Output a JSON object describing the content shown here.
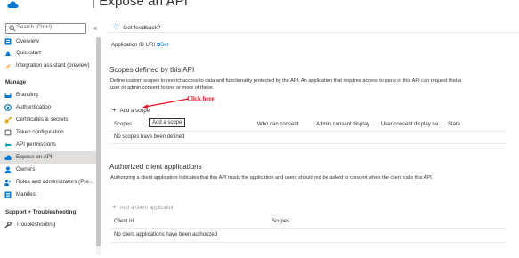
{
  "header": {
    "title": "Expose an API",
    "pin_icon": "pin-icon",
    "logo_icon": "azure-cloud-icon"
  },
  "sidebar": {
    "search_placeholder": "Search (Ctrl+/)",
    "collapse_glyph": "«",
    "items_top": [
      {
        "label": "Overview",
        "icon": "overview-icon"
      },
      {
        "label": "Quickstart",
        "icon": "quickstart-icon"
      },
      {
        "label": "Integration assistant (preview)",
        "icon": "rocket-icon"
      }
    ],
    "manage_heading": "Manage",
    "items_manage": [
      {
        "label": "Branding",
        "icon": "branding-icon"
      },
      {
        "label": "Authentication",
        "icon": "authentication-icon"
      },
      {
        "label": "Certificates & secrets",
        "icon": "key-icon"
      },
      {
        "label": "Token configuration",
        "icon": "token-icon"
      },
      {
        "label": "API permissions",
        "icon": "api-permissions-icon"
      },
      {
        "label": "Expose an API",
        "icon": "cloud-icon",
        "active": true
      },
      {
        "label": "Owners",
        "icon": "owners-icon"
      },
      {
        "label": "Roles and administrators (Pre...",
        "icon": "roles-icon"
      },
      {
        "label": "Manifest",
        "icon": "manifest-icon"
      }
    ],
    "support_heading": "Support + Troubleshooting",
    "items_support": [
      {
        "label": "Troubleshooting",
        "icon": "wrench-icon"
      }
    ]
  },
  "toolbar": {
    "feedback_label": "Got feedback?"
  },
  "app_id": {
    "label": "Application ID URI",
    "set_label": "Set"
  },
  "scopes": {
    "title": "Scopes defined by this API",
    "description": "Define custom scopes to restrict access to data and functionality protected by the API. An application that requires access to parts of this API can request that a user or admin consent to one or more of these.",
    "add_label": "Add a scope",
    "tooltip": "Add a scope",
    "annotation": "Click here",
    "columns": [
      "Scopes",
      "Who can consent",
      "Admin consent display ...",
      "User consent display na...",
      "State"
    ],
    "empty": "No scopes have been defined"
  },
  "clients": {
    "title": "Authorized client applications",
    "description": "Authorizing a client application indicates that this API trusts the application and users should not be asked to consent when the client calls this API.",
    "add_label": "Add a client application",
    "columns": [
      "Client Id",
      "Scopes"
    ],
    "empty": "No client applications have been authorized"
  },
  "colors": {
    "accent": "#0078d4",
    "annotation": "#e81123",
    "active_bg": "#e1dfdd"
  }
}
